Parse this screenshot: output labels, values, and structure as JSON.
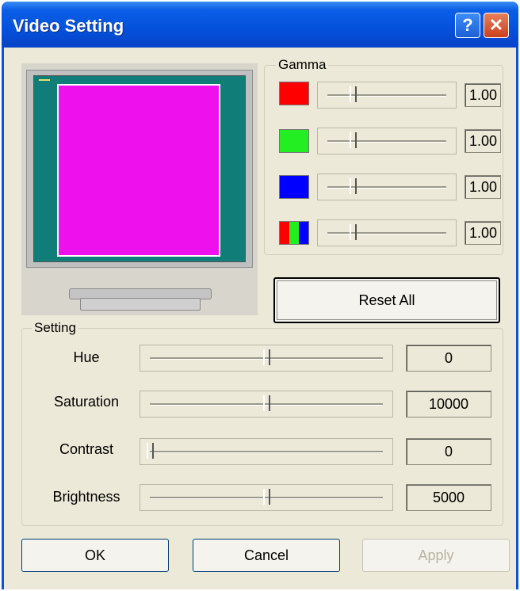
{
  "window": {
    "title": "Video Setting"
  },
  "titlebar": {
    "help": "?",
    "close": "✕"
  },
  "gamma": {
    "legend": "Gamma",
    "channels": [
      {
        "name": "red",
        "color": "#ff0000",
        "value_text": "1.00",
        "slider_pct": 22
      },
      {
        "name": "green",
        "color": "#22ee22",
        "value_text": "1.00",
        "slider_pct": 22
      },
      {
        "name": "blue",
        "color": "#0000ff",
        "value_text": "1.00",
        "slider_pct": 22
      },
      {
        "name": "all",
        "colors": [
          "#ff0000",
          "#22ee22",
          "#0000ff"
        ],
        "value_text": "1.00",
        "slider_pct": 22
      }
    ]
  },
  "reset_label": "Reset All",
  "setting": {
    "legend": "Setting",
    "rows": [
      {
        "label": "Hue",
        "value": "0",
        "slider_pct": 50
      },
      {
        "label": "Saturation",
        "value": "10000",
        "slider_pct": 50
      },
      {
        "label": "Contrast",
        "value": "0",
        "slider_pct": 0
      },
      {
        "label": "Brightness",
        "value": "5000",
        "slider_pct": 50
      }
    ]
  },
  "buttons": {
    "ok": "OK",
    "cancel": "Cancel",
    "apply": "Apply"
  },
  "preview": {
    "screen_color": "#117d79",
    "content_color": "#ee11ee"
  }
}
